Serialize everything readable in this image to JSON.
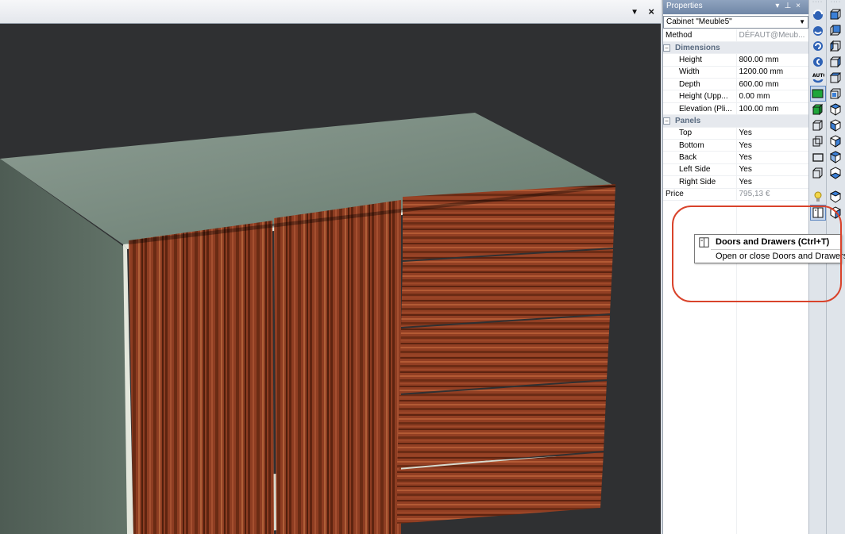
{
  "viewport": {
    "dropdown_icon": "chevron-down-icon",
    "close_icon": "close-icon",
    "dropdown_glyph": "▼",
    "close_glyph": "×"
  },
  "properties": {
    "title": "Properties",
    "pin_icon": "pin-icon",
    "object_selector": "Cabinet \"Meuble5\"",
    "rows": {
      "method": {
        "label": "Method",
        "value": "DÉFAUT@Meub..."
      },
      "dimensions": {
        "label": "Dimensions"
      },
      "height": {
        "label": "Height",
        "value": "800.00 mm"
      },
      "width": {
        "label": "Width",
        "value": "1200.00 mm"
      },
      "depth": {
        "label": "Depth",
        "value": "600.00 mm"
      },
      "height_upper": {
        "label": "Height (Upp...",
        "value": "0.00 mm"
      },
      "elevation": {
        "label": "Elevation (Pli...",
        "value": "100.00 mm"
      },
      "panels": {
        "label": "Panels"
      },
      "top": {
        "label": "Top",
        "value": "Yes"
      },
      "bottom": {
        "label": "Bottom",
        "value": "Yes"
      },
      "back": {
        "label": "Back",
        "value": "Yes"
      },
      "left_side": {
        "label": "Left Side",
        "value": "Yes"
      },
      "right_side": {
        "label": "Right Side",
        "value": "Yes"
      },
      "price": {
        "label": "Price",
        "value": "795,13 €"
      }
    }
  },
  "tooltip": {
    "title": "Doors and Drawers (Ctrl+T)",
    "description": "Open or close Doors and Drawers",
    "icon": "doors-drawers-icon"
  },
  "colors": {
    "viewport_bg": "#2f3032",
    "highlight": "#d9432b",
    "wood": "#8b3a1f",
    "carcass": "#5e6f64"
  }
}
